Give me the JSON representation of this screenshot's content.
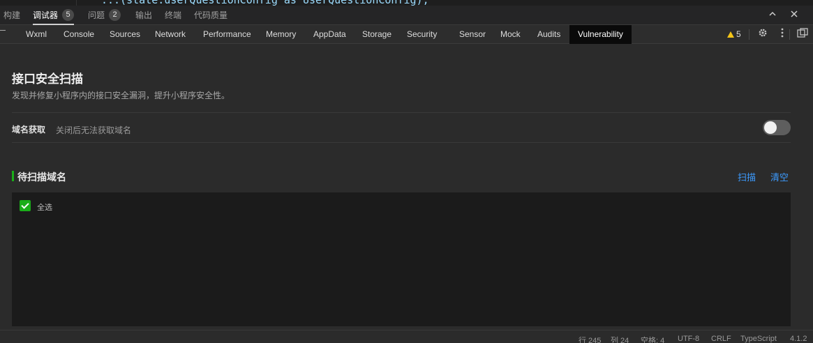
{
  "editor": {
    "code_line": "...(state.userQuestionConfig as UserQuestionConfig),"
  },
  "panel_tabs": [
    {
      "label": "构建",
      "badge": null
    },
    {
      "label": "调试器",
      "badge": "5",
      "active": true
    },
    {
      "label": "问题",
      "badge": "2"
    },
    {
      "label": "输出",
      "badge": null
    },
    {
      "label": "终端",
      "badge": null
    },
    {
      "label": "代码质量",
      "badge": null
    }
  ],
  "window_controls": {
    "collapse": "chevron-up-icon",
    "close": "close-icon"
  },
  "devtools_tabs": [
    "Wxml",
    "Console",
    "Sources",
    "Network",
    "Performance",
    "Memory",
    "AppData",
    "Storage",
    "Security",
    "Sensor",
    "Mock",
    "Audits",
    "Vulnerability"
  ],
  "active_devtools_tab": "Vulnerability",
  "toolbar": {
    "warning_count": "5",
    "icons": [
      "gear-icon",
      "more-vertical-icon",
      "dock-icon"
    ]
  },
  "main": {
    "title": "接口安全扫描",
    "subtitle": "发现并修复小程序内的接口安全漏洞，提升小程序安全性。",
    "domain_fetch": {
      "label": "域名获取",
      "desc": "关闭后无法获取域名",
      "enabled": false
    },
    "section": {
      "title": "待扫描域名",
      "actions": {
        "scan": "扫描",
        "clear": "清空"
      },
      "select_all": {
        "label": "全选",
        "checked": true
      }
    }
  },
  "statusbar": {
    "line": "行 245",
    "col": "列 24",
    "spaces": "空格: 4",
    "encoding": "UTF-8",
    "eol": "CRLF",
    "language": "TypeScript",
    "version": "4.1.2"
  },
  "colors": {
    "accent_green": "#1aad19",
    "link_blue": "#3c9bff",
    "warning": "#f5c518"
  }
}
